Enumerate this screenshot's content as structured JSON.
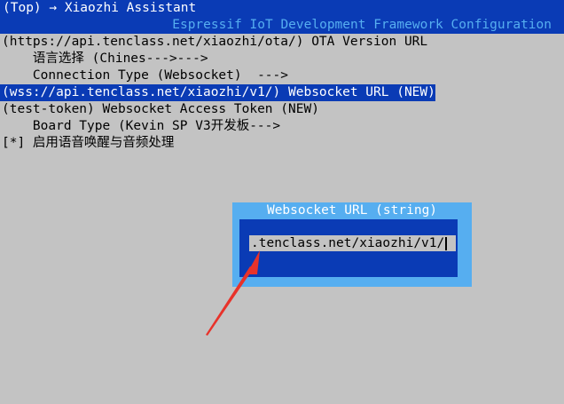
{
  "top_bar": {
    "title": "(Top) → Xiaozhi Assistant"
  },
  "frame_bar": {
    "title": "Espressif IoT Development Framework Configuration"
  },
  "menu": {
    "items": [
      {
        "text": "(https://api.tenclass.net/xiaozhi/ota/) OTA Version URL",
        "selected": false
      },
      {
        "text": "    语言选择 (Chines--->--->",
        "selected": false
      },
      {
        "text": "    Connection Type (Websocket)  --->",
        "selected": false
      },
      {
        "text": "(wss://api.tenclass.net/xiaozhi/v1/) Websocket URL (NEW)",
        "selected": true
      },
      {
        "text": "(test-token) Websocket Access Token (NEW)",
        "selected": false
      },
      {
        "text": "    Board Type (Kevin SP V3开发板--->",
        "selected": false
      },
      {
        "text": "[*] 启用语音唤醒与音频处理",
        "selected": false
      }
    ]
  },
  "dialog": {
    "title": "Websocket URL (string)",
    "input_value": ".tenclass.net/xiaozhi/v1/"
  },
  "annotation": {
    "arrow_color": "#e8322a",
    "icon": "red-arrow-icon"
  },
  "colors": {
    "background": "#c3c3c3",
    "bar_blue": "#0a3bb5",
    "title_light_blue": "#56aef0",
    "dialog_frame": "#56aef0"
  }
}
